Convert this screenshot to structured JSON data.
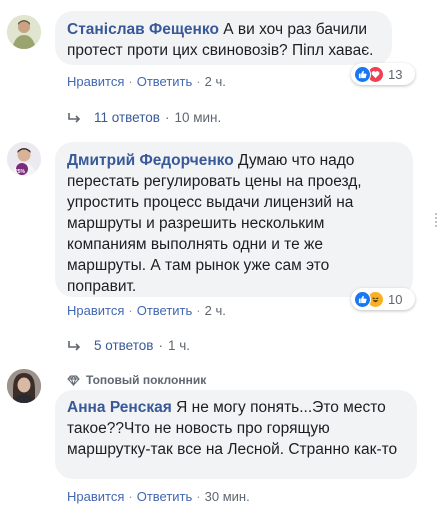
{
  "comments": [
    {
      "author": "Станіслав Фещенко",
      "text": "А ви хоч раз бачили протест проти цих свиновозів? Піпл хаває.",
      "like_label": "Нравится",
      "reply_label": "Ответить",
      "time": "2 ч.",
      "reactions": [
        "like",
        "love"
      ],
      "reaction_count": "13",
      "replies_label": "11 ответов",
      "replies_time": "10 мин."
    },
    {
      "author": "Дмитрий Федорченко",
      "text": "Думаю что надо перестать регулировать цены на проезд, упростить процесс выдачи лицензий на маршруты и разрешить нескольким компаниям выполнять одни и те же маршруты. А там рынок уже сам это поправит.",
      "avatar_badge": "25%",
      "like_label": "Нравится",
      "reply_label": "Ответить",
      "time": "2 ч.",
      "reactions": [
        "like",
        "haha"
      ],
      "reaction_count": "10",
      "replies_label": "5 ответов",
      "replies_time": "1 ч."
    },
    {
      "badge": "Топовый поклонник",
      "author": "Анна Ренская",
      "text": "Я не могу понять...Это место такое??Что не новость про горящую маршрутку-так все на Лесной. Странно как-то",
      "like_label": "Нравится",
      "reply_label": "Ответить",
      "time": "30 мин."
    }
  ],
  "colors": {
    "link": "#385898",
    "action_link": "#4267b2",
    "meta": "#606770",
    "bubble": "#f2f3f5",
    "like": "#1877f2",
    "love": "#f33e58",
    "haha": "#f7b125"
  },
  "icons": [
    "reply-arrow-icon",
    "like-reaction-icon",
    "love-reaction-icon",
    "haha-reaction-icon",
    "diamond-badge-icon"
  ]
}
